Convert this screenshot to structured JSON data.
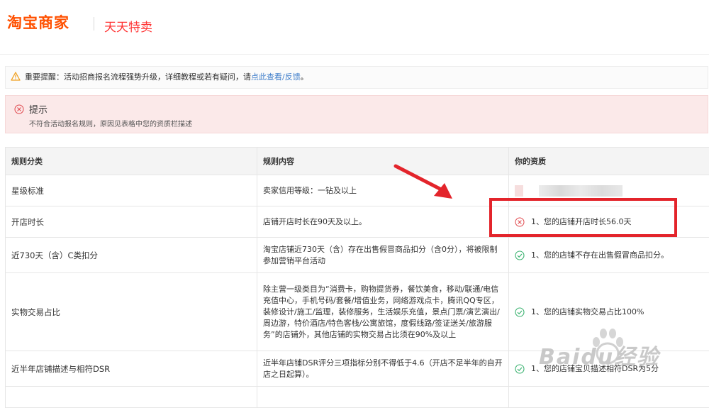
{
  "header": {
    "logo": "淘宝商家",
    "subbrand": "天天特卖"
  },
  "notice": {
    "text": "重要提醒：活动招商报名流程强势升级，详细教程或若有疑问，请",
    "link": "点此查看/反馈",
    "suffix": "。"
  },
  "alert": {
    "title": "提示",
    "description": "不符合活动报名规则，原因见表格中您的资质栏描述"
  },
  "table": {
    "headers": [
      "规则分类",
      "规则内容",
      "你的资质"
    ],
    "rows": [
      {
        "category": "星级标准",
        "content": "卖家信用等级：一钻及以上",
        "qualification": "",
        "status": "blurred"
      },
      {
        "category": "开店时长",
        "content": "店铺开店时长在90天及以上。",
        "qualification": "1、您的店铺开店时长56.0天",
        "status": "fail"
      },
      {
        "category": "近730天（含）C类扣分",
        "content": "淘宝店铺近730天（含）存在出售假冒商品扣分（含0分），将被限制参加营销平台活动",
        "qualification": "1、您的店铺不存在出售假冒商品扣分。",
        "status": "pass"
      },
      {
        "category": "实物交易占比",
        "content": "除主营一级类目为“消费卡，购物提货券，餐饮美食，移动/联通/电信充值中心，手机号码/套餐/增值业务，网络游戏点卡，腾讯QQ专区，装修设计/施工/监理，装修服务，生活娱乐充值，景点门票/演艺演出/周边游，特价酒店/特色客栈/公寓旅馆，度假线路/签证送关/旅游服务”的店铺外，其他店铺的实物交易占比须在90%及以上",
        "qualification": "1、您的店铺实物交易占比100%",
        "status": "pass"
      },
      {
        "category": "近半年店铺描述与相符DSR",
        "content": "近半年店铺DSR评分三项指标分别不得低于4.6（开店不足半年的自开店之日起算）。",
        "qualification": "1、您的店铺宝贝描述相符DSR为5分",
        "status": "pass"
      }
    ]
  },
  "watermark": {
    "text": "Baidu经验"
  },
  "colors": {
    "brand": "#ff5000",
    "alert_bg": "#fbe9e9",
    "pass": "#3cb371",
    "fail": "#e0474c",
    "highlight": "#e3242b",
    "link": "#3d7cc9"
  }
}
